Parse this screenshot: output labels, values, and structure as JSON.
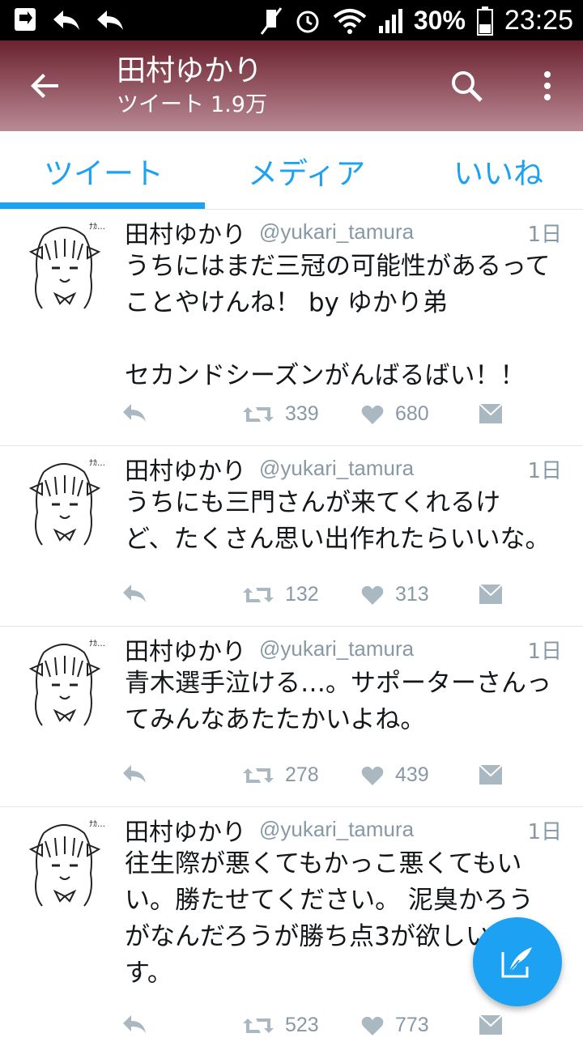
{
  "status_bar": {
    "battery": "30%",
    "time": "23:25"
  },
  "header": {
    "title": "田村ゆかり",
    "subtitle_label": "ツイート",
    "subtitle_count": "1.9万"
  },
  "tabs": [
    {
      "label": "ツイート",
      "active": true
    },
    {
      "label": "メディア",
      "active": false
    },
    {
      "label": "いいね",
      "active": false
    }
  ],
  "tweets": [
    {
      "name": "田村ゆかり",
      "handle": "@yukari_tamura",
      "time": "1日",
      "text": "うちにはまだ三冠の可能性があるって\nことやけんね！ by ゆかり弟\n\nセカンドシーズンがんばるばい！！",
      "retweets": "339",
      "likes": "680"
    },
    {
      "name": "田村ゆかり",
      "handle": "@yukari_tamura",
      "time": "1日",
      "text": "うちにも三門さんが来てくれるけ\nど、たくさん思い出作れたらいいな。",
      "retweets": "132",
      "likes": "313"
    },
    {
      "name": "田村ゆかり",
      "handle": "@yukari_tamura",
      "time": "1日",
      "text": "青木選手泣ける…。サポーターさんっ\nてみんなあたたかいよね。",
      "retweets": "278",
      "likes": "439"
    },
    {
      "name": "田村ゆかり",
      "handle": "@yukari_tamura",
      "time": "1日",
      "text": "往生際が悪くてもかっこ悪くてもい\nい。勝たせてください。 泥臭かろう\nがなんだろうが勝ち点3が欲しいで\nす。",
      "retweets": "523",
      "likes": "773"
    }
  ],
  "colors": {
    "accent": "#1da1f2",
    "appbar_top": "#6b2230",
    "appbar_bottom": "#b98a93",
    "muted": "#8899a6"
  },
  "icons": [
    "back-arrow-icon",
    "search-icon",
    "more-vert-icon",
    "reply-icon",
    "retweet-icon",
    "heart-icon",
    "message-icon",
    "compose-icon"
  ]
}
